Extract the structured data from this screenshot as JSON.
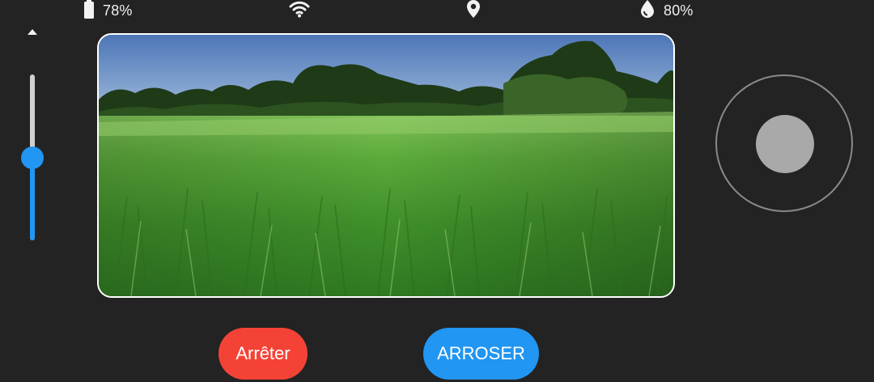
{
  "status": {
    "battery": {
      "icon": "battery-icon",
      "value": "78%"
    },
    "wifi": {
      "icon": "wifi-icon"
    },
    "location": {
      "icon": "location-pin-icon"
    },
    "humidity": {
      "icon": "water-drop-icon",
      "value": "80%"
    }
  },
  "slider": {
    "icon": "arrow-up-icon",
    "level": 0.5
  },
  "camera": {
    "feed": "grass-field-image"
  },
  "joystick": {
    "label": "joystick"
  },
  "buttons": {
    "stop_label": "Arrêter",
    "water_label": "ARROSER"
  },
  "colors": {
    "background": "#232323",
    "accent": "#2196f3",
    "stop": "#f44336"
  }
}
